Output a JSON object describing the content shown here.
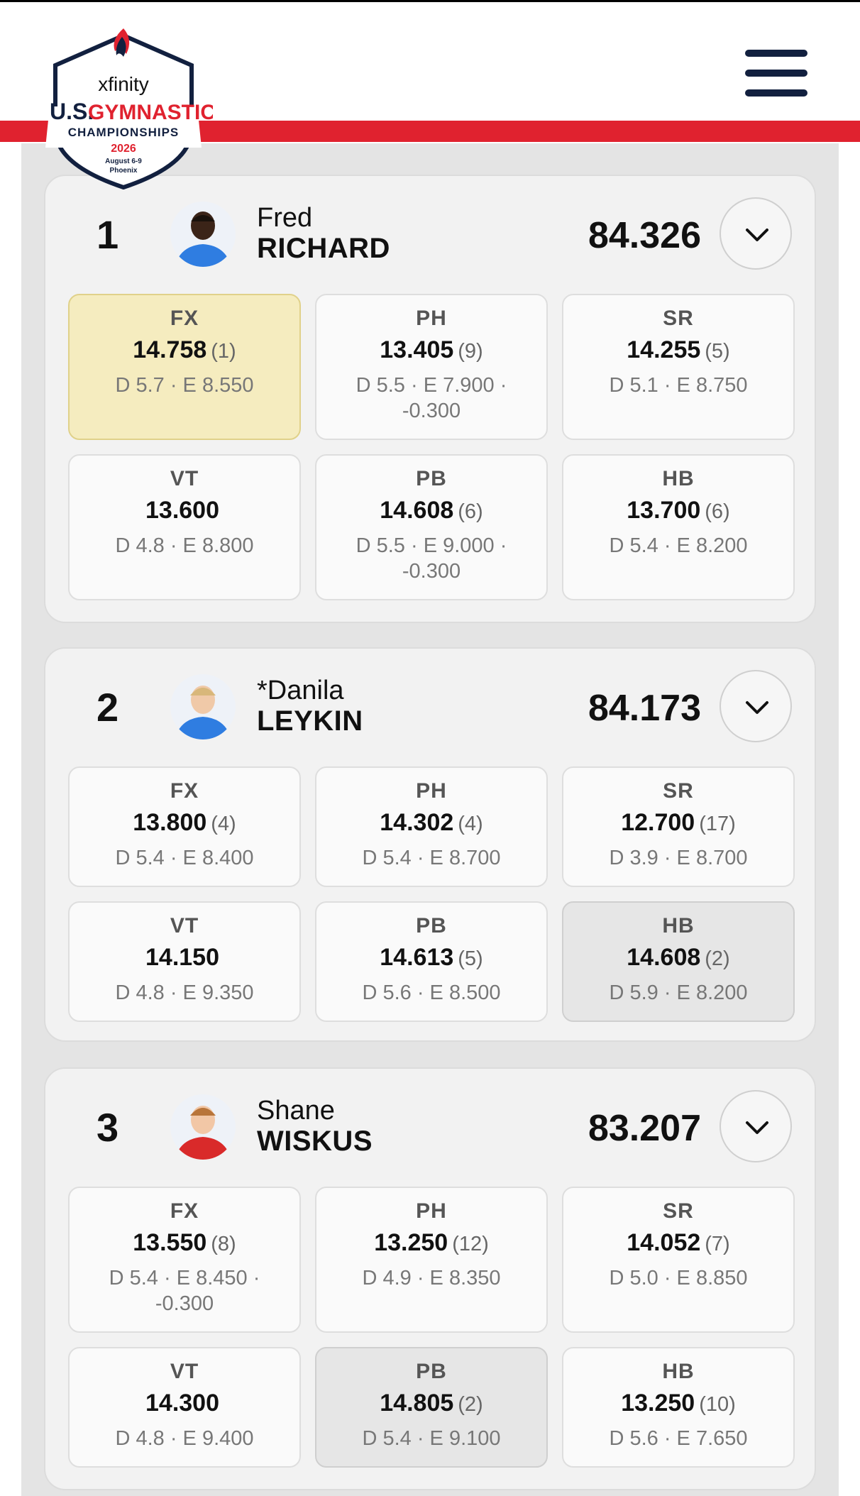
{
  "header": {
    "logo": {
      "sponsor": "xfinity",
      "brand_us": "U.S.",
      "brand_gym": "GYMNASTICS",
      "event": "CHAMPIONSHIPS",
      "year": "2026",
      "dates": "August 6-9",
      "city": "Phoenix"
    },
    "menu_icon": "hamburger-icon"
  },
  "colors": {
    "accent_red": "#e0222f",
    "navy": "#12203f",
    "best_tile": "#f5ecbf",
    "highlight_tile": "#e6e6e6"
  },
  "athletes": [
    {
      "rank": "1",
      "first": "Fred",
      "last": "RICHARD",
      "total": "84.326",
      "events": [
        {
          "ev": "FX",
          "score": "14.758",
          "place": "(1)",
          "de": "D 5.7 · E 8.550"
        },
        {
          "ev": "PH",
          "score": "13.405",
          "place": "(9)",
          "de": "D 5.5 · E 7.900 · -0.300"
        },
        {
          "ev": "SR",
          "score": "14.255",
          "place": "(5)",
          "de": "D 5.1 · E 8.750"
        },
        {
          "ev": "VT",
          "score": "13.600",
          "place": "",
          "de": "D 4.8 · E 8.800"
        },
        {
          "ev": "PB",
          "score": "14.608",
          "place": "(6)",
          "de": "D 5.5 · E 9.000 · -0.300"
        },
        {
          "ev": "HB",
          "score": "13.700",
          "place": "(6)",
          "de": "D 5.4 · E 8.200"
        }
      ]
    },
    {
      "rank": "2",
      "first": "*Danila",
      "last": "LEYKIN",
      "total": "84.173",
      "events": [
        {
          "ev": "FX",
          "score": "13.800",
          "place": "(4)",
          "de": "D 5.4 · E 8.400"
        },
        {
          "ev": "PH",
          "score": "14.302",
          "place": "(4)",
          "de": "D 5.4 · E 8.700"
        },
        {
          "ev": "SR",
          "score": "12.700",
          "place": "(17)",
          "de": "D 3.9 · E 8.700"
        },
        {
          "ev": "VT",
          "score": "14.150",
          "place": "",
          "de": "D 4.8 · E 9.350"
        },
        {
          "ev": "PB",
          "score": "14.613",
          "place": "(5)",
          "de": "D 5.6 · E 8.500"
        },
        {
          "ev": "HB",
          "score": "14.608",
          "place": "(2)",
          "de": "D 5.9 · E 8.200"
        }
      ]
    },
    {
      "rank": "3",
      "first": "Shane",
      "last": "WISKUS",
      "total": "83.207",
      "events": [
        {
          "ev": "FX",
          "score": "13.550",
          "place": "(8)",
          "de": "D 5.4 · E 8.450 · -0.300"
        },
        {
          "ev": "PH",
          "score": "13.250",
          "place": "(12)",
          "de": "D 4.9 · E 8.350"
        },
        {
          "ev": "SR",
          "score": "14.052",
          "place": "(7)",
          "de": "D 5.0 · E 8.850"
        },
        {
          "ev": "VT",
          "score": "14.300",
          "place": "",
          "de": "D 4.8 · E 9.400"
        },
        {
          "ev": "PB",
          "score": "14.805",
          "place": "(2)",
          "de": "D 5.4 · E 9.100"
        },
        {
          "ev": "HB",
          "score": "13.250",
          "place": "(10)",
          "de": "D 5.6 · E 7.650"
        }
      ]
    }
  ]
}
